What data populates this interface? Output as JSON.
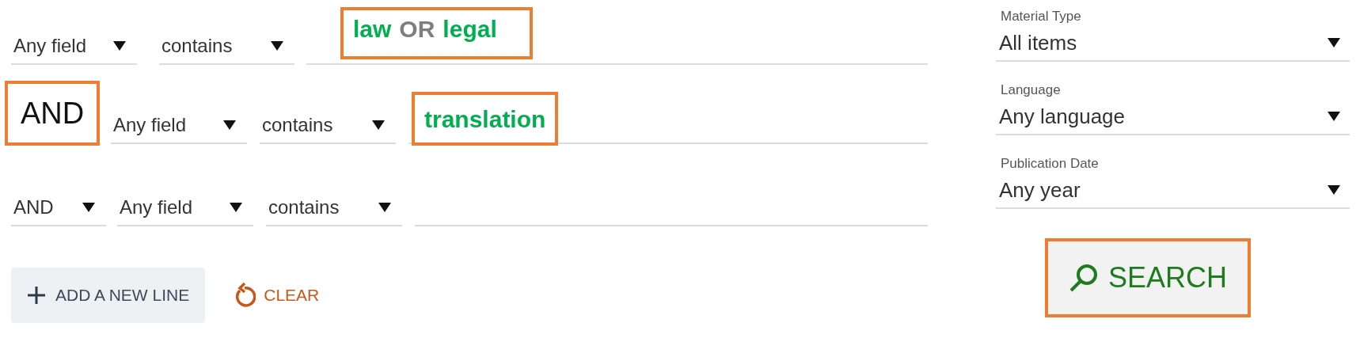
{
  "query_rows": [
    {
      "field": {
        "text": "Any field"
      },
      "condition": {
        "text": "contains"
      },
      "query": {
        "highlighted": true,
        "parts": [
          {
            "text": "law",
            "kind": "term"
          },
          {
            "text": "OR",
            "kind": "operator"
          },
          {
            "text": "legal",
            "kind": "term"
          }
        ]
      }
    },
    {
      "operator": {
        "text": "AND",
        "kind": "plain",
        "highlighted": true
      },
      "field": {
        "text": "Any field"
      },
      "condition": {
        "text": "contains"
      },
      "query": {
        "highlighted": true,
        "parts": [
          {
            "text": "translation",
            "kind": "term"
          }
        ]
      }
    },
    {
      "operator": {
        "text": "AND",
        "kind": "select"
      },
      "field": {
        "text": "Any field"
      },
      "condition": {
        "text": "contains"
      }
    }
  ],
  "facets": [
    {
      "label": "Material Type",
      "value": "All items"
    },
    {
      "label": "Language",
      "value": "Any language"
    },
    {
      "label": "Publication Date",
      "value": "Any year"
    }
  ],
  "actions": {
    "add_line": {
      "label": "ADD A NEW LINE"
    },
    "clear": {
      "label": "CLEAR"
    },
    "search": {
      "label": "SEARCH",
      "highlighted": true
    }
  }
}
